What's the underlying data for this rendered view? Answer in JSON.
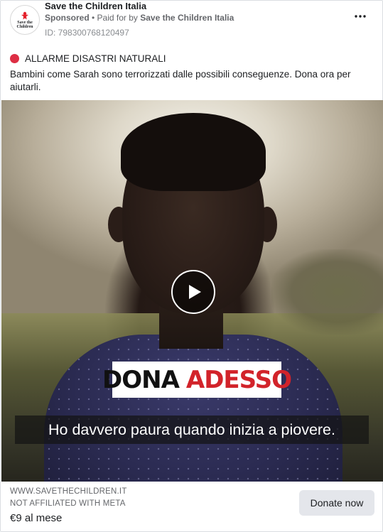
{
  "advertiser": {
    "name": "Save the Children Italia",
    "logo_text_line1": "Save the",
    "logo_text_line2": "Children",
    "logo_color": "#e4202a"
  },
  "meta": {
    "sponsored": "Sponsored",
    "separator": " • ",
    "paid_prefix": "Paid for by ",
    "paid_by": "Save the Children Italia",
    "ad_id": "ID: 798300768120497"
  },
  "more_icon": "more-horizontal-icon",
  "post": {
    "alert_icon": "red-circle-icon",
    "alert_text": "ALLARME DISASTRI NATURALI",
    "body": "Bambini come Sarah sono terrorizzati dalle possibili conseguenze. Dona ora per aiutarli."
  },
  "video": {
    "play_icon": "play-icon",
    "banner_word1": "DONA",
    "banner_word2": "ADESSO",
    "banner_accent": "#d2232a",
    "subtitle": "Ho davvero paura quando inizia a piovere."
  },
  "footer": {
    "domain": "WWW.SAVETHECHILDREN.IT",
    "affiliation": "NOT AFFILIATED WITH META",
    "price": "€9 al mese",
    "cta_label": "Donate now"
  }
}
